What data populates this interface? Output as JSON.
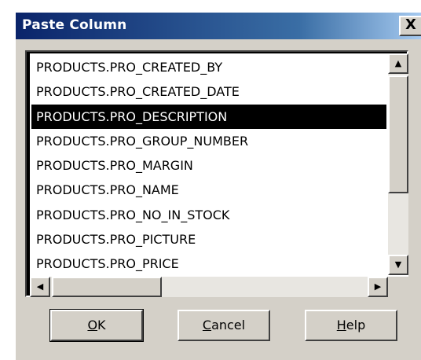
{
  "window": {
    "title": "Paste Column",
    "close_glyph": "X"
  },
  "list": {
    "items": [
      "PRODUCTS.PRO_CREATED_BY",
      "PRODUCTS.PRO_CREATED_DATE",
      "PRODUCTS.PRO_DESCRIPTION",
      "PRODUCTS.PRO_GROUP_NUMBER",
      "PRODUCTS.PRO_MARGIN",
      "PRODUCTS.PRO_NAME",
      "PRODUCTS.PRO_NO_IN_STOCK",
      "PRODUCTS.PRO_PICTURE",
      "PRODUCTS.PRO_PRICE"
    ],
    "selected_index": 2
  },
  "scrollbar": {
    "up_icon": "scroll-up-arrow-icon",
    "down_icon": "scroll-down-arrow-icon",
    "left_icon": "scroll-left-arrow-icon",
    "right_icon": "scroll-right-arrow-icon"
  },
  "buttons": {
    "ok": {
      "mnemonic": "O",
      "rest": "K"
    },
    "cancel": {
      "mnemonic": "C",
      "rest": "ancel"
    },
    "help": {
      "mnemonic": "H",
      "rest": "elp"
    }
  },
  "colors": {
    "title_bar": "#0a246a",
    "selection": "#000000",
    "dialog_face": "#d4d0c8"
  }
}
